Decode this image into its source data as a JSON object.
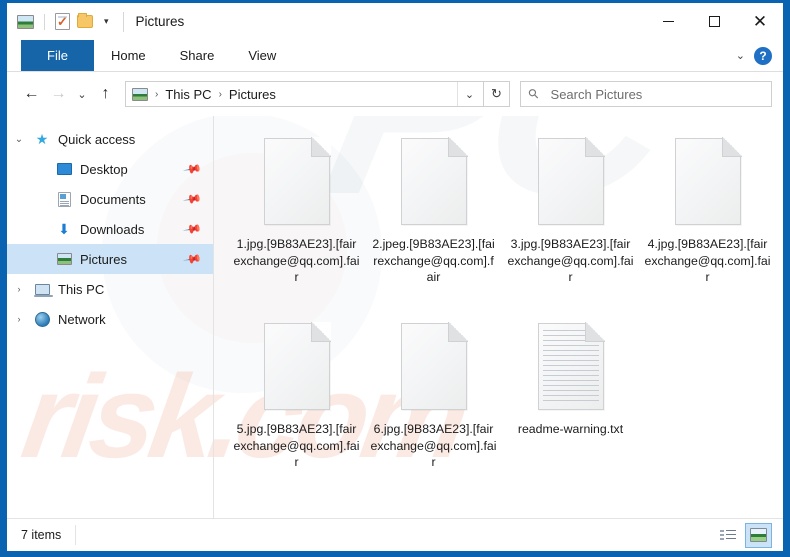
{
  "window": {
    "title": "Pictures",
    "quick_access_toolbar": [
      {
        "name": "picture-properties-icon",
        "label": "Pictures"
      },
      {
        "name": "properties-icon",
        "label": "Properties"
      },
      {
        "name": "new-folder-icon",
        "label": "New folder"
      },
      {
        "name": "customize-chevron-icon",
        "label": "▾"
      }
    ],
    "controls": {
      "minimize": "—",
      "maximize": "▢",
      "close": "✕"
    }
  },
  "ribbon": {
    "tabs": [
      {
        "label": "File",
        "active": true
      },
      {
        "label": "Home",
        "active": false
      },
      {
        "label": "Share",
        "active": false
      },
      {
        "label": "View",
        "active": false
      }
    ],
    "expand_label": "⌄",
    "help_label": "?"
  },
  "address": {
    "back_label": "←",
    "forward_label": "→",
    "recent_label": "⌄",
    "up_label": "↑",
    "breadcrumbs": [
      "This PC",
      "Pictures"
    ],
    "separator": "›",
    "dropdown_label": "⌄",
    "refresh_label": "↻"
  },
  "search": {
    "placeholder": "Search Pictures",
    "value": "",
    "icon_label": "⚲"
  },
  "sidebar": {
    "items": [
      {
        "label": "Quick access",
        "icon": "star-icon",
        "twisty": "⌄",
        "expanded": true,
        "indent": false,
        "pinned": false,
        "selected": false
      },
      {
        "label": "Desktop",
        "icon": "desktop-icon",
        "twisty": "",
        "expanded": false,
        "indent": true,
        "pinned": true,
        "selected": false
      },
      {
        "label": "Documents",
        "icon": "documents-icon",
        "twisty": "",
        "expanded": false,
        "indent": true,
        "pinned": true,
        "selected": false
      },
      {
        "label": "Downloads",
        "icon": "downloads-icon",
        "twisty": "",
        "expanded": false,
        "indent": true,
        "pinned": true,
        "selected": false
      },
      {
        "label": "Pictures",
        "icon": "pictures-icon",
        "twisty": "",
        "expanded": false,
        "indent": true,
        "pinned": true,
        "selected": true
      },
      {
        "label": "This PC",
        "icon": "this-pc-icon",
        "twisty": "›",
        "expanded": false,
        "indent": false,
        "pinned": false,
        "selected": false
      },
      {
        "label": "Network",
        "icon": "network-icon",
        "twisty": "›",
        "expanded": false,
        "indent": false,
        "pinned": false,
        "selected": false
      }
    ],
    "pin_glyph": "📌"
  },
  "files": [
    {
      "name": "1.jpg.[9B83AE23].[fairexchange@qq.com].fair",
      "type": "blank-document"
    },
    {
      "name": "2.jpeg.[9B83AE23].[fairexchange@qq.com].fair",
      "type": "blank-document"
    },
    {
      "name": "3.jpg.[9B83AE23].[fairexchange@qq.com].fair",
      "type": "blank-document"
    },
    {
      "name": "4.jpg.[9B83AE23].[fairexchange@qq.com].fair",
      "type": "blank-document"
    },
    {
      "name": "5.jpg.[9B83AE23].[fairexchange@qq.com].fair",
      "type": "blank-document"
    },
    {
      "name": "6.jpg.[9B83AE23].[fairexchange@qq.com].fair",
      "type": "blank-document"
    },
    {
      "name": "readme-warning.txt",
      "type": "text-document"
    }
  ],
  "status": {
    "items_count": "7 items",
    "views": [
      {
        "name": "details-view",
        "active": false
      },
      {
        "name": "large-icons-view",
        "active": true
      }
    ]
  },
  "watermarks": {
    "brand": "risk.com",
    "faint": "PC"
  },
  "colors": {
    "window_border": "#0a63b0",
    "file_tab": "#1565a8",
    "selection": "#cce3f7",
    "accent": "#1f6fc4",
    "watermark_orange": "#e78056"
  }
}
